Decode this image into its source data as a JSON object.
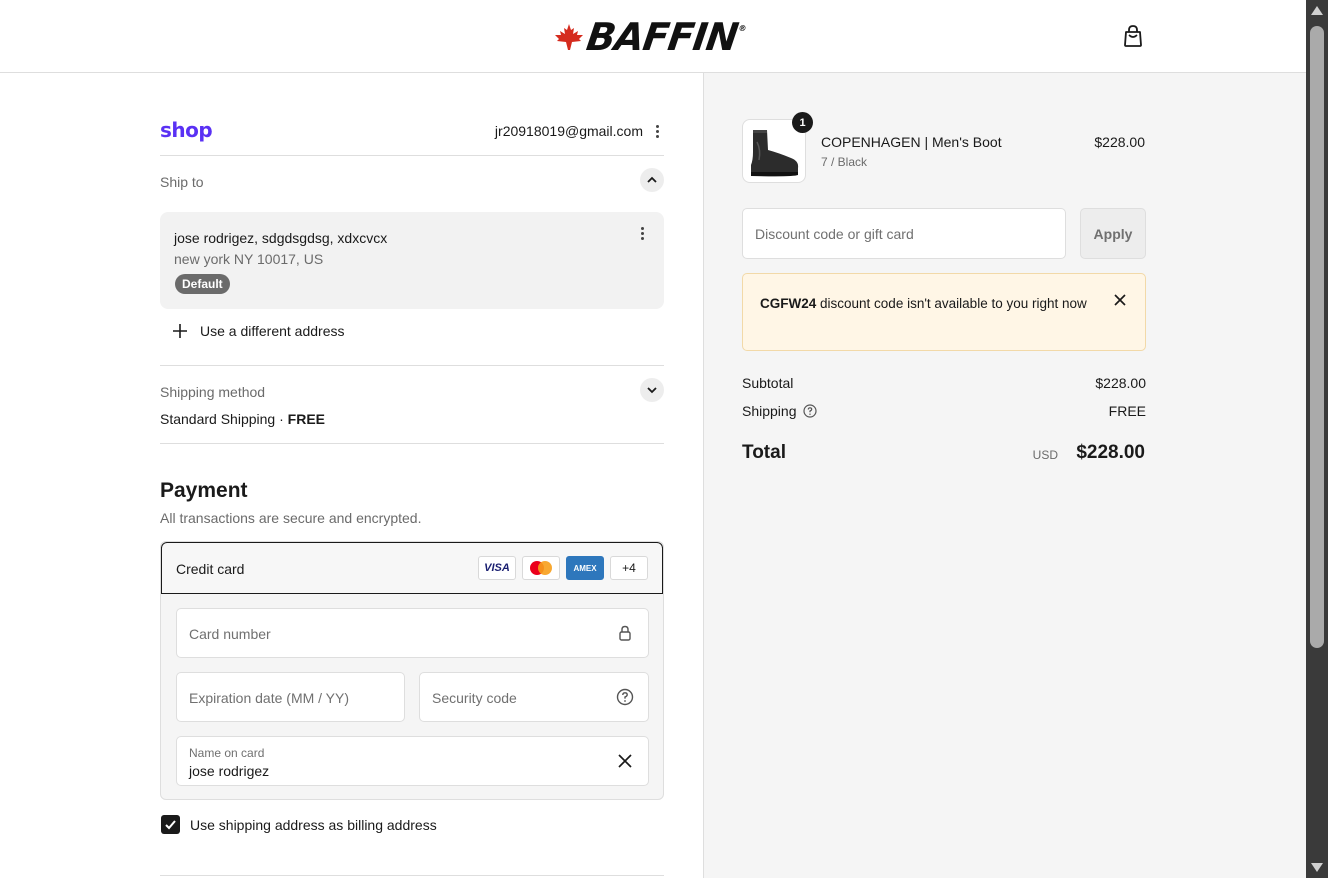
{
  "header": {
    "brand": "BAFFIN",
    "brand_mark": "®"
  },
  "account": {
    "shop_logo": "shop",
    "email": "jr20918019@gmail.com"
  },
  "ship_to": {
    "label": "Ship to",
    "address_line1": "jose rodrigez, sdgdsgdsg, xdxcvcx",
    "address_line2": "new york NY 10017, US",
    "badge": "Default",
    "different_address": "Use a different address"
  },
  "shipping_method": {
    "label": "Shipping method",
    "value": "Standard Shipping",
    "separator": "·",
    "price": "FREE"
  },
  "payment": {
    "title": "Payment",
    "subtitle": "All transactions are secure and encrypted.",
    "method": "Credit card",
    "cards": [
      "VISA",
      "AMEX",
      "+4"
    ],
    "card_number_placeholder": "Card number",
    "expiration_placeholder": "Expiration date (MM / YY)",
    "security_placeholder": "Security code",
    "name_label": "Name on card",
    "name_value": "jose rodrigez",
    "billing_checkbox": "Use shipping address as billing address",
    "billing_checked": true
  },
  "order": {
    "item": {
      "quantity": "1",
      "name": "COPENHAGEN | Men's Boot",
      "variant": "7 / Black",
      "price": "$228.00"
    },
    "discount_placeholder": "Discount code or gift card",
    "apply_label": "Apply",
    "notice_code": "CGFW24",
    "notice_text": " discount code isn't available to you right now",
    "subtotal_label": "Subtotal",
    "subtotal": "$228.00",
    "shipping_label": "Shipping",
    "shipping": "FREE",
    "total_label": "Total",
    "currency": "USD",
    "total": "$228.00"
  },
  "colors": {
    "shop_purple": "#5a31f4",
    "maple_red": "#d52b1e",
    "notice_bg": "#fff6e6"
  }
}
